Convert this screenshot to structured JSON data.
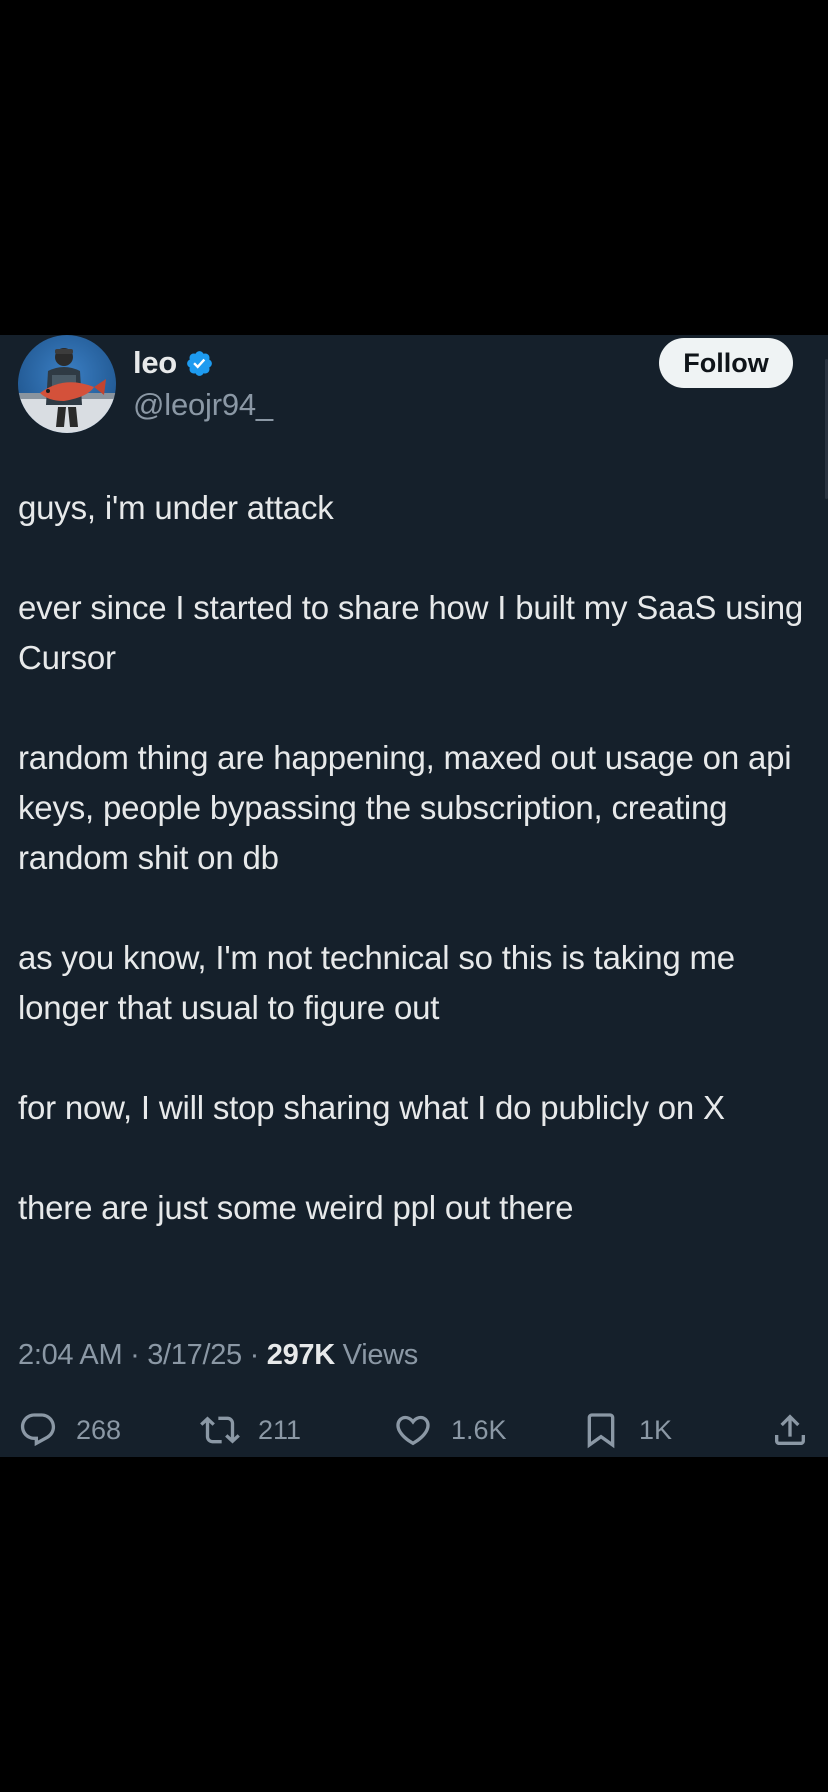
{
  "author": {
    "display_name": "leo",
    "handle": "@leojr94_",
    "verified_badge_icon": "verified-badge-icon"
  },
  "follow_button": {
    "label": "Follow"
  },
  "tweet": {
    "paragraphs": [
      "guys, i'm under attack",
      "ever since I started to share how I built my SaaS using Cursor",
      "random thing are happening, maxed out usage on api keys, people bypassing the subscription, creating random shit on db",
      "as you know, I'm not technical so this is taking me longer that usual to figure out",
      "for now, I will stop sharing what I do publicly on X",
      "there are just some weird ppl out there"
    ]
  },
  "meta": {
    "time": "2:04 AM",
    "separator": "·",
    "date": "3/17/25",
    "views_count": "297K",
    "views_label": "Views"
  },
  "actions": {
    "reply": {
      "icon": "reply-icon",
      "count": "268"
    },
    "retweet": {
      "icon": "retweet-icon",
      "count": "211"
    },
    "like": {
      "icon": "heart-icon",
      "count": "1.6K"
    },
    "bookmark": {
      "icon": "bookmark-icon",
      "count": "1K"
    },
    "share": {
      "icon": "share-icon"
    }
  },
  "colors": {
    "background": "#000000",
    "card": "#15202b",
    "text_primary": "#e7e9ea",
    "text_secondary": "#8b98a5",
    "verified_blue": "#1d9bf0",
    "follow_bg": "#eff3f4"
  }
}
